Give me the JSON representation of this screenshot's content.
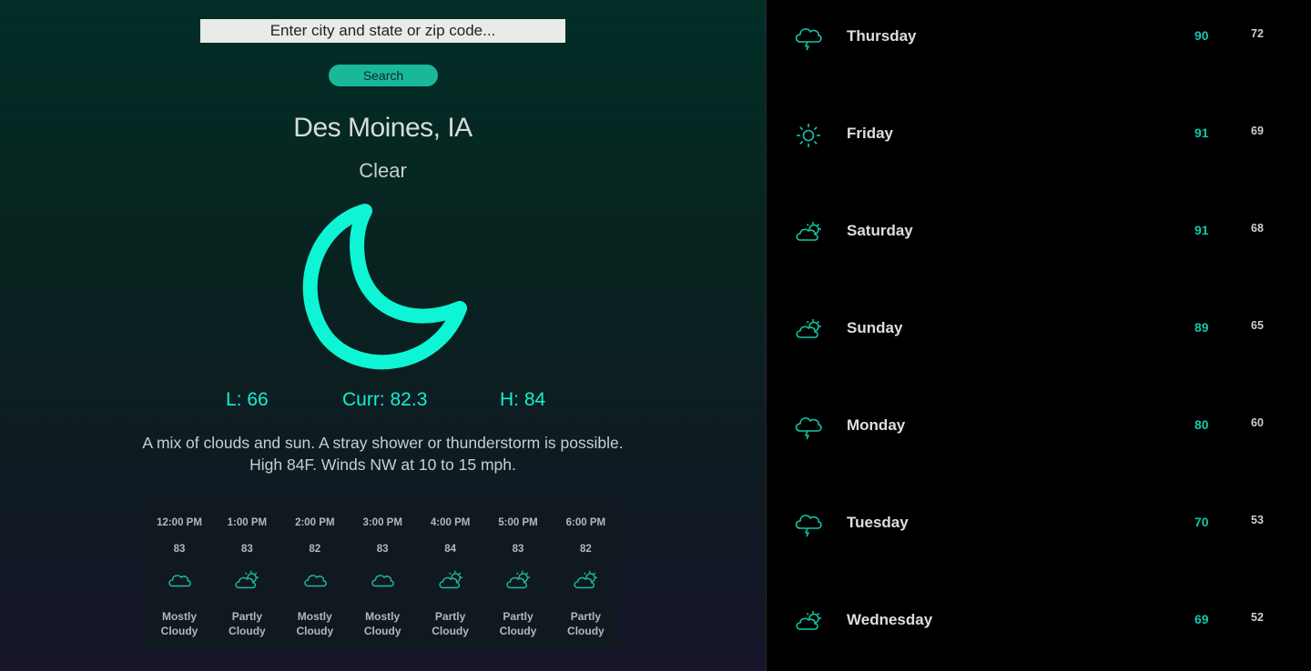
{
  "search": {
    "placeholder": "Enter city and state or zip code...",
    "button_label": "Search"
  },
  "current": {
    "location": "Des Moines, IA",
    "condition": "Clear",
    "icon": "moon-icon",
    "low": "L: 66",
    "current": "Curr: 82.3",
    "high": "H: 84",
    "summary_line1": "A mix of clouds and sun. A stray shower or thunderstorm is possible.",
    "summary_line2": "High 84F. Winds NW at 10 to 15 mph."
  },
  "hourly": [
    {
      "time": "12:00 PM",
      "temp": "83",
      "icon": "cloud",
      "cond1": "Mostly",
      "cond2": "Cloudy"
    },
    {
      "time": "1:00 PM",
      "temp": "83",
      "icon": "partly-cloudy",
      "cond1": "Partly",
      "cond2": "Cloudy"
    },
    {
      "time": "2:00 PM",
      "temp": "82",
      "icon": "cloud",
      "cond1": "Mostly",
      "cond2": "Cloudy"
    },
    {
      "time": "3:00 PM",
      "temp": "83",
      "icon": "cloud",
      "cond1": "Mostly",
      "cond2": "Cloudy"
    },
    {
      "time": "4:00 PM",
      "temp": "84",
      "icon": "partly-cloudy",
      "cond1": "Partly",
      "cond2": "Cloudy"
    },
    {
      "time": "5:00 PM",
      "temp": "83",
      "icon": "partly-cloudy",
      "cond1": "Partly",
      "cond2": "Cloudy"
    },
    {
      "time": "6:00 PM",
      "temp": "82",
      "icon": "partly-cloudy",
      "cond1": "Partly",
      "cond2": "Cloudy"
    }
  ],
  "forecast": [
    {
      "day": "Thursday",
      "high": "90",
      "low": "72",
      "icon": "thunderstorm"
    },
    {
      "day": "Friday",
      "high": "91",
      "low": "69",
      "icon": "sun"
    },
    {
      "day": "Saturday",
      "high": "91",
      "low": "68",
      "icon": "partly-cloudy"
    },
    {
      "day": "Sunday",
      "high": "89",
      "low": "65",
      "icon": "partly-cloudy"
    },
    {
      "day": "Monday",
      "high": "80",
      "low": "60",
      "icon": "thunderstorm"
    },
    {
      "day": "Tuesday",
      "high": "70",
      "low": "53",
      "icon": "thunderstorm"
    },
    {
      "day": "Wednesday",
      "high": "69",
      "low": "52",
      "icon": "partly-cloudy"
    }
  ],
  "colors": {
    "accent": "#14f0d0",
    "accent_dark": "#12c7a6",
    "button": "#1ab89a",
    "hourly_icon": "#1fb89c"
  }
}
